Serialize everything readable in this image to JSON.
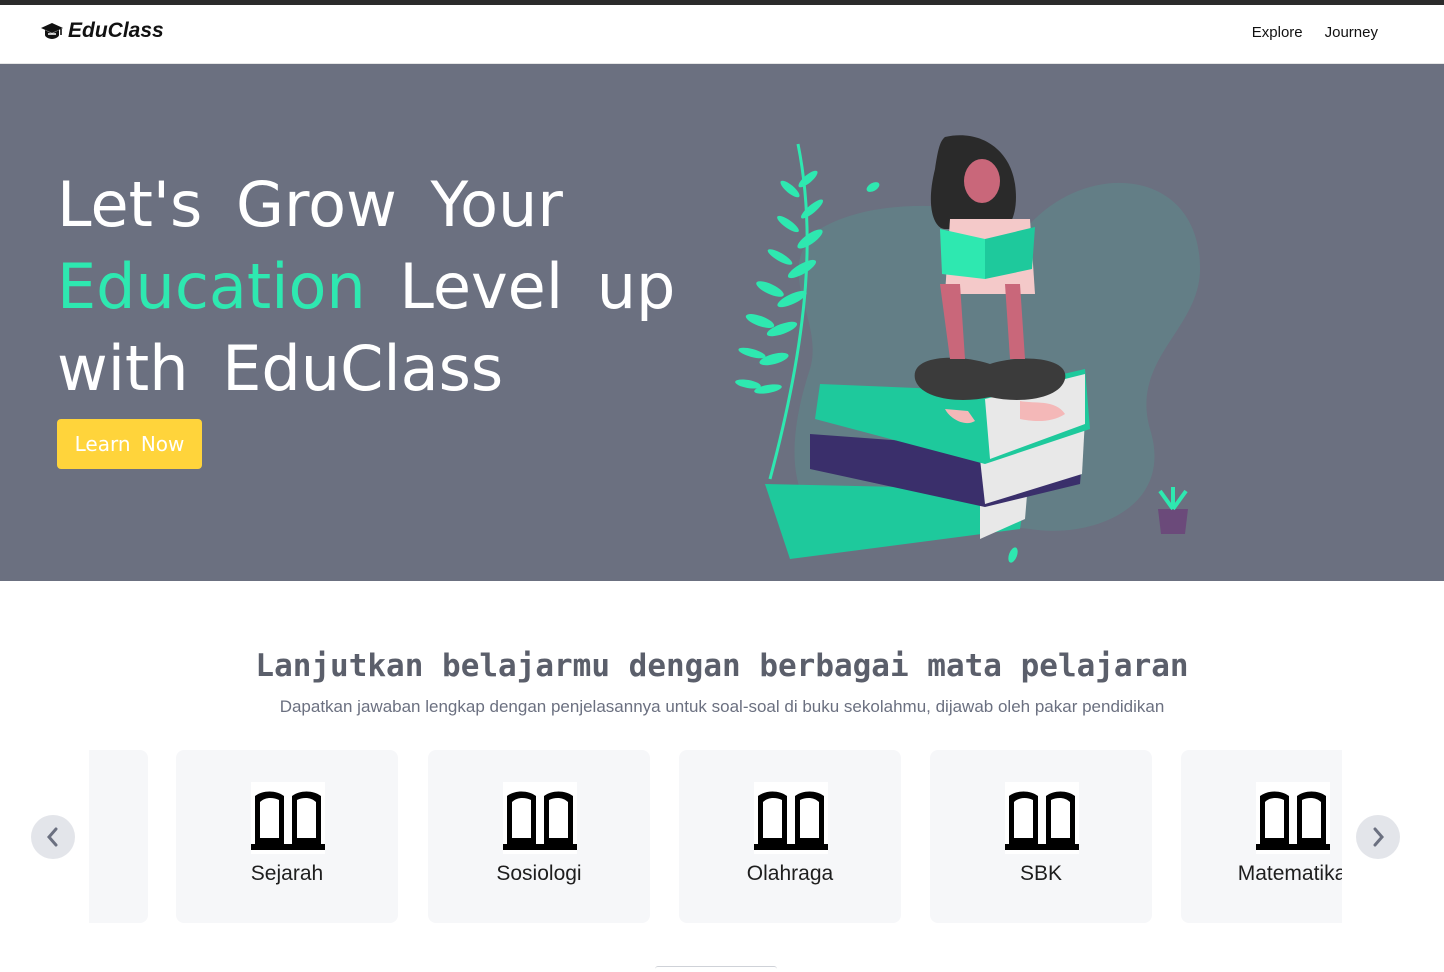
{
  "navbar": {
    "brand": "EduClass",
    "links": [
      "Explore",
      "Journey"
    ]
  },
  "hero": {
    "line1": "Let's Grow Your",
    "line2_accent": "Education",
    "line2_rest": "Level up",
    "line3": "with EduClass",
    "cta": "Learn Now",
    "accent_color": "#2ee8b0",
    "cta_color": "#ffd43b",
    "background": "#6b7080"
  },
  "section": {
    "title": "Lanjutkan belajarmu dengan berbagai mata pelajaran",
    "subtitle": "Dapatkan jawaban lengkap dengan penjelasannya untuk soal-soal di buku sekolahmu, dijawab oleh pakar pendidikan"
  },
  "subjects": [
    {
      "label": "",
      "icon": "book-open-icon"
    },
    {
      "label": "Sejarah",
      "icon": "book-open-icon"
    },
    {
      "label": "Sosiologi",
      "icon": "book-open-icon"
    },
    {
      "label": "Olahraga",
      "icon": "book-open-icon"
    },
    {
      "label": "SBK",
      "icon": "book-open-icon"
    },
    {
      "label": "Matematika",
      "icon": "book-open-icon"
    }
  ],
  "carousel": {
    "prev_icon": "chevron-left-icon",
    "next_icon": "chevron-right-icon"
  }
}
